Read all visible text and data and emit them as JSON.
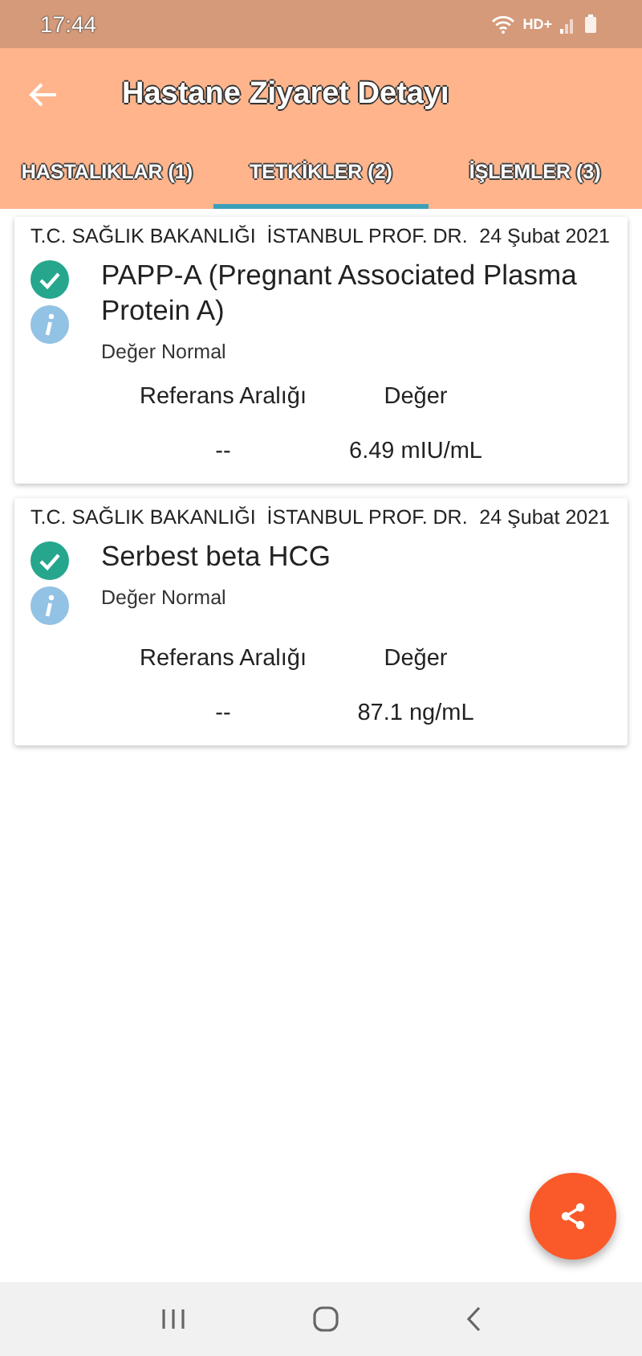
{
  "status_bar": {
    "time": "17:44",
    "network": "HD+"
  },
  "app_bar": {
    "title": "Hastane Ziyaret Detayı"
  },
  "tabs": [
    {
      "label": "HASTALIKLAR (1)",
      "selected": false
    },
    {
      "label": "TETKİKLER (2)",
      "selected": true
    },
    {
      "label": "İŞLEMLER (3)",
      "selected": false
    }
  ],
  "tests": [
    {
      "source": "T.C. SAĞLIK BAKANLIĞI  İSTANBUL PROF. DR.",
      "date": "24 Şubat 2021",
      "name": "PAPP-A (Pregnant Associated Plasma Protein A)",
      "status": "Değer Normal",
      "range_label": "Referans Aralığı",
      "value_label": "Değer",
      "range": "--",
      "value": "6.49 mIU/mL"
    },
    {
      "source": "T.C. SAĞLIK BAKANLIĞI  İSTANBUL PROF. DR.",
      "date": "24 Şubat 2021",
      "name": "Serbest beta HCG",
      "status": "Değer Normal",
      "range_label": "Referans Aralığı",
      "value_label": "Değer",
      "range": "--",
      "value": "87.1 ng/mL"
    }
  ]
}
